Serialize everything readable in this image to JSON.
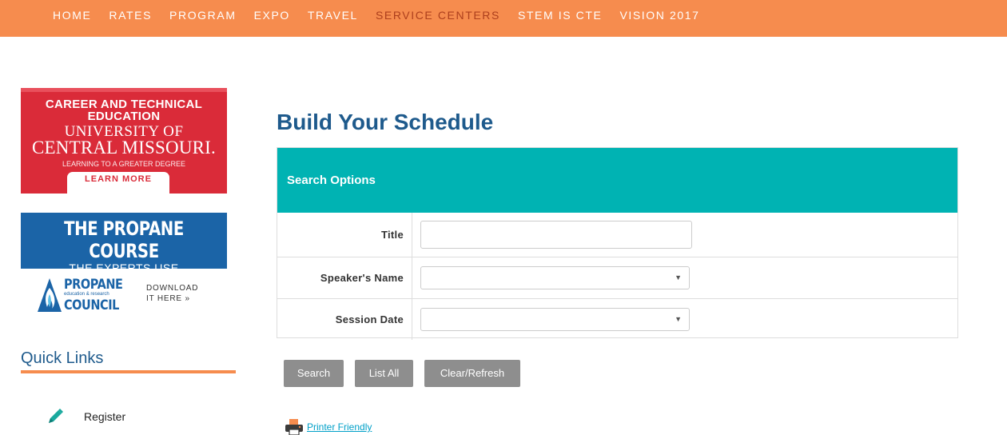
{
  "nav": {
    "items": [
      "HOME",
      "RATES",
      "PROGRAM",
      "EXPO",
      "TRAVEL",
      "SERVICE CENTERS",
      "STEM IS CTE",
      "VISION 2017"
    ],
    "active_index": 5,
    "bar_color": "#f68c4e",
    "active_color": "#ad3f1d"
  },
  "ads": {
    "ucm": {
      "line1": "CAREER AND TECHNICAL",
      "line2": "EDUCATION",
      "line3": "UNIVERSITY OF",
      "line4": "CENTRAL MISSOURI.",
      "tagline": "LEARNING TO A GREATER DEGREE",
      "button": "LEARN MORE",
      "color": "#da2b39"
    },
    "propane": {
      "headline": "THE PROPANE COURSE",
      "subhead": "THE EXPERTS USE",
      "logo_word1": "PROPANE",
      "logo_small": "education & research",
      "logo_word2": "COUNCIL",
      "download_line1": "DOWNLOAD",
      "download_line2": "IT HERE »",
      "color": "#1b64a7"
    }
  },
  "quick_links": {
    "title": "Quick Links",
    "items": [
      {
        "label": "Register",
        "icon": "pencil-icon"
      }
    ]
  },
  "main": {
    "title": "Build Your Schedule",
    "search": {
      "heading": "Search Options",
      "fields": {
        "title_label": "Title",
        "title_value": "",
        "speaker_label": "Speaker's Name",
        "speaker_value": "",
        "date_label": "Session Date",
        "date_value": ""
      }
    },
    "buttons": {
      "search": "Search",
      "list_all": "List All",
      "clear": "Clear/Refresh"
    },
    "printer_link": "Printer Friendly",
    "accent_color": "#00b3b3"
  }
}
